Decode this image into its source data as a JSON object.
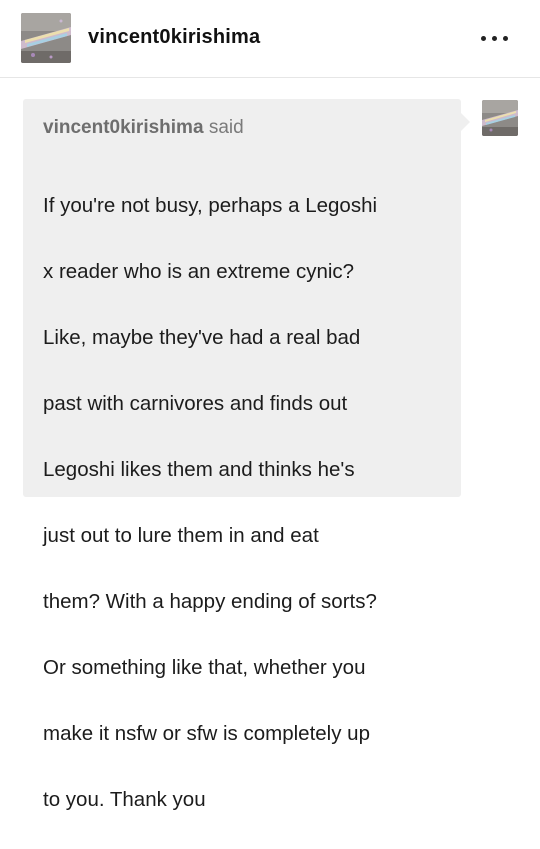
{
  "header": {
    "blog_name": "vincent0kirishima",
    "more_icon": "more-horizontal-icon"
  },
  "ask": {
    "asker_name": "vincent0kirishima",
    "said_label": "said",
    "lines": [
      "If you're not busy, perhaps a Legoshi",
      "x reader who is an extreme cynic?",
      "Like, maybe they've had a real bad",
      "past with carnivores and finds out",
      "Legoshi likes them and thinks he's",
      "just out to lure them in and eat",
      "them? With a happy ending of sorts?",
      "Or something like that, whether you",
      "make it nsfw or sfw is completely up",
      "to you. Thank you"
    ]
  },
  "colors": {
    "bubble": "#efefef",
    "divider": "#e6e6e6",
    "asker_text": "#7a7a7a"
  }
}
